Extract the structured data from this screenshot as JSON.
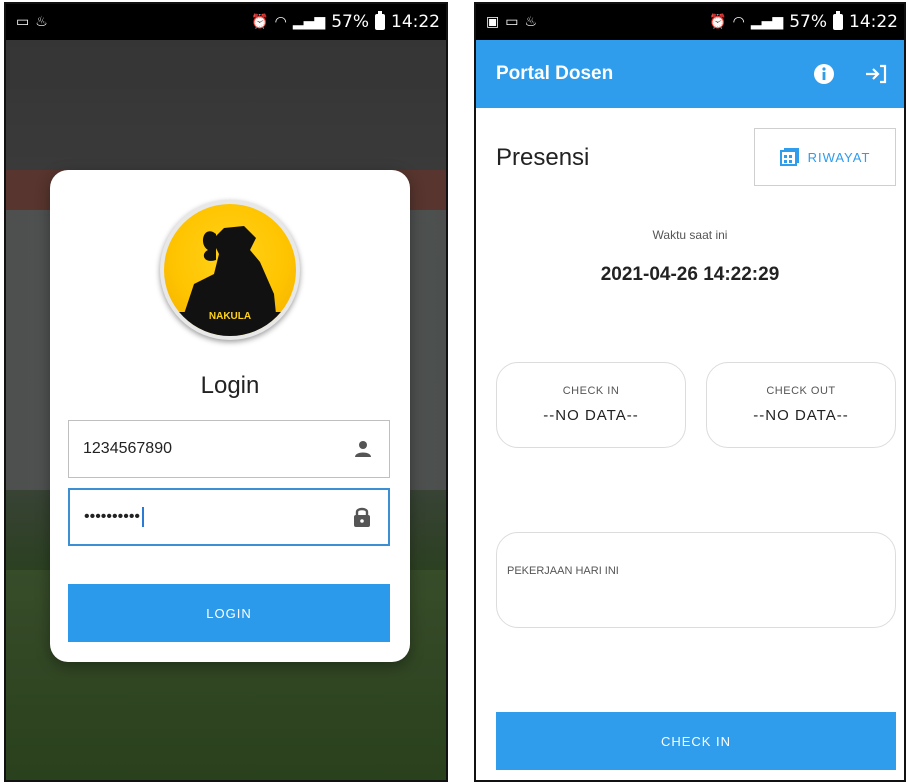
{
  "status_bar": {
    "battery": "57%",
    "time": "14:22"
  },
  "login_screen": {
    "logo_text": "NAKULA",
    "title": "Login",
    "username_value": "1234567890",
    "password_value": "••••••••••",
    "login_button": "LOGIN"
  },
  "portal_screen": {
    "app_title": "Portal Dosen",
    "page_title": "Presensi",
    "history_button": "RIWAYAT",
    "current_time_label": "Waktu saat ini",
    "current_time_value": "2021-04-26 14:22:29",
    "check_in": {
      "label": "CHECK IN",
      "value": "--NO DATA--"
    },
    "check_out": {
      "label": "CHECK OUT",
      "value": "--NO DATA--"
    },
    "work_today_label": "PEKERJAAN HARI INI",
    "check_in_button": "CHECK IN"
  },
  "colors": {
    "primary": "#2f9cec",
    "focus_border": "#3d8fd4",
    "logo_yellow": "#ffc400"
  },
  "icons": [
    "user-icon",
    "lock-icon",
    "info-icon",
    "logout-icon",
    "calendar-icon"
  ]
}
